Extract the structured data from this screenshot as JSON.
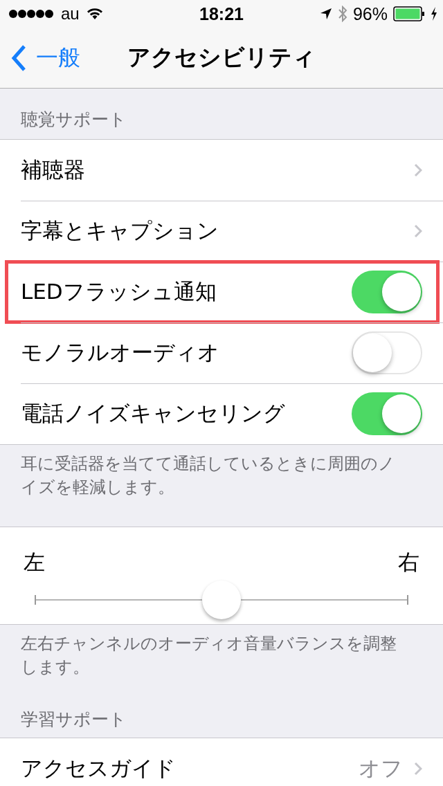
{
  "status_bar": {
    "carrier": "au",
    "time": "18:21",
    "battery": "96%"
  },
  "nav": {
    "back": "一般",
    "title": "アクセシビリティ"
  },
  "sections": [
    {
      "kind": "list",
      "header": "聴覚サポート",
      "rows": [
        {
          "kind": "link",
          "label": "補聴器",
          "highlighted": false
        },
        {
          "kind": "link",
          "label": "字幕とキャプション",
          "highlighted": false
        },
        {
          "kind": "toggle",
          "label": "LEDフラッシュ通知",
          "on": true,
          "highlighted": true
        },
        {
          "kind": "toggle",
          "label": "モノラルオーディオ",
          "on": false,
          "highlighted": false
        },
        {
          "kind": "toggle",
          "label": "電話ノイズキャンセリング",
          "on": true,
          "highlighted": false
        }
      ],
      "footer": "耳に受話器を当てて通話しているときに周囲のノイズを軽減します。"
    },
    {
      "kind": "balance",
      "left": "左",
      "right": "右",
      "level": 0.5,
      "footer": "左右チャンネルのオーディオ音量バランスを調整します。"
    },
    {
      "kind": "list",
      "header": "学習サポート",
      "rows": [
        {
          "kind": "link",
          "label": "アクセスガイド",
          "value": "オフ",
          "highlighted": false
        }
      ]
    }
  ]
}
